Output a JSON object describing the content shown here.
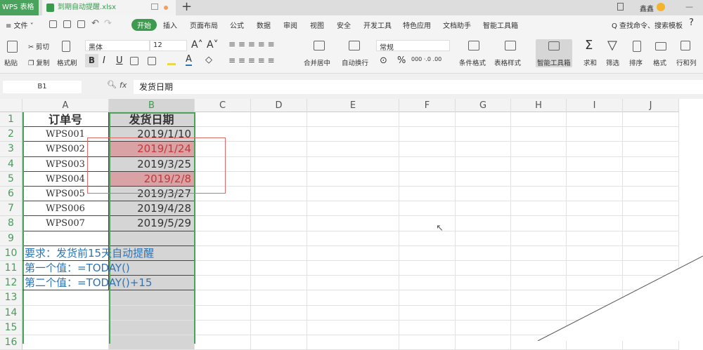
{
  "titlebar": {
    "app_tab": "WPS 表格",
    "doc_tab": "到期自动提醒.xlsx",
    "new_tab": "+",
    "user": "鑫鑫"
  },
  "menu": {
    "file": "≡ 文件 ˅",
    "items": [
      "开始",
      "插入",
      "页面布局",
      "公式",
      "数据",
      "审阅",
      "视图",
      "安全",
      "开发工具",
      "特色应用",
      "文档助手",
      "智能工具箱"
    ],
    "search": "Q 查找命令、搜索模板",
    "help": "?"
  },
  "toolbar": {
    "paste": "粘贴",
    "cut": "剪切",
    "copy": "复制",
    "format_painter": "格式刷",
    "font": "黑体",
    "size": "12",
    "number_format": "常规",
    "merge": "合并居中",
    "wrap": "自动换行",
    "cond_format": "条件格式",
    "table_style": "表格样式",
    "smart_tools": "智能工具箱",
    "sum": "求和",
    "filter": "筛选",
    "sort": "排序",
    "format": "格式",
    "rowcol": "行和列",
    "bold": "B",
    "italic": "I",
    "underline": "U",
    "percent": "%"
  },
  "formula_bar": {
    "cell_ref": "B1",
    "fx": "fx",
    "value": "发货日期"
  },
  "sheet": {
    "columns": [
      "A",
      "B",
      "C",
      "D",
      "E",
      "F",
      "G",
      "H",
      "I",
      "J"
    ],
    "rows": [
      [
        "订单号",
        "发货日期"
      ],
      [
        "WPS001",
        "2019/1/10"
      ],
      [
        "WPS002",
        "2019/1/24"
      ],
      [
        "WPS003",
        "2019/3/25"
      ],
      [
        "WPS004",
        "2019/2/8"
      ],
      [
        "WPS005",
        "2019/3/27"
      ],
      [
        "WPS006",
        "2019/4/28"
      ],
      [
        "WPS007",
        "2019/5/29"
      ],
      [
        "",
        ""
      ],
      [
        "要求：发货前15天自动提醒",
        ""
      ],
      [
        "第一个值：=TODAY()",
        ""
      ],
      [
        "第二个值：=TODAY()+15",
        ""
      ],
      [
        "",
        ""
      ],
      [
        "",
        ""
      ],
      [
        "",
        ""
      ],
      [
        "",
        ""
      ]
    ],
    "highlight_rows": [
      3,
      5
    ],
    "colors": {
      "accent": "#3d9a4f",
      "highlight_fill": "#d9a3a6",
      "highlight_text": "#c0393b",
      "note_text": "#2f74b5",
      "selection": "#4aa35c"
    }
  }
}
